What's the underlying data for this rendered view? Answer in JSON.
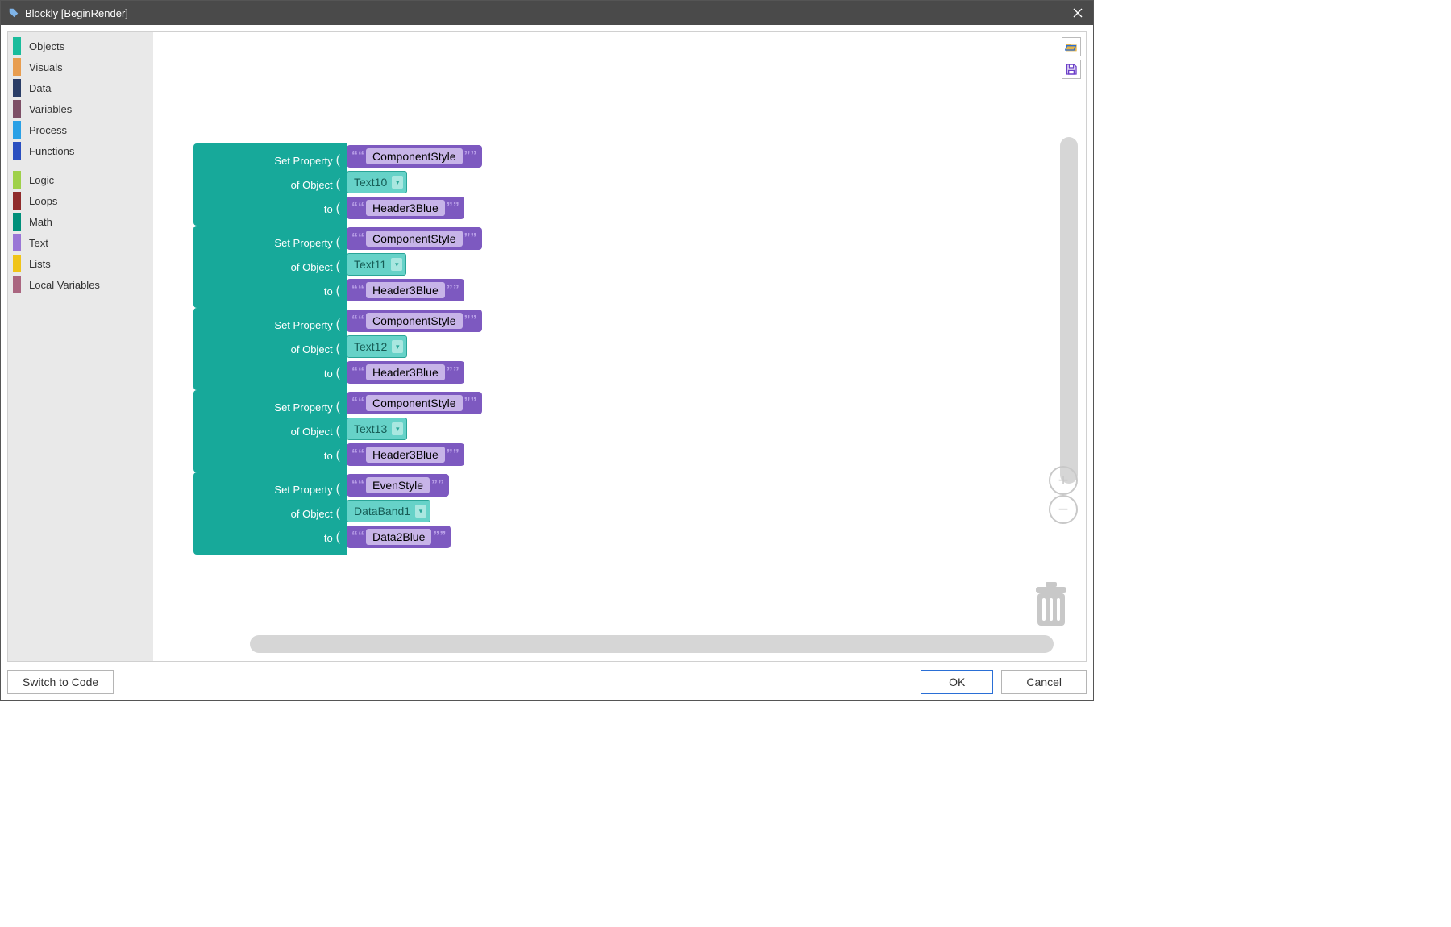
{
  "window_title": "Blockly [BeginRender]",
  "footer": {
    "switch": "Switch to Code",
    "ok": "OK",
    "cancel": "Cancel"
  },
  "sidebar": {
    "groups": [
      [
        {
          "color": "#1abc9c",
          "label": "Objects"
        },
        {
          "color": "#e89d4f",
          "label": "Visuals"
        },
        {
          "color": "#2a3d66",
          "label": "Data"
        },
        {
          "color": "#7d4f66",
          "label": "Variables"
        },
        {
          "color": "#2aa0e6",
          "label": "Process"
        },
        {
          "color": "#2a4fc0",
          "label": "Functions"
        }
      ],
      [
        {
          "color": "#9fd14a",
          "label": "Logic"
        },
        {
          "color": "#8f2b2b",
          "label": "Loops"
        },
        {
          "color": "#008f7a",
          "label": "Math"
        },
        {
          "color": "#9a76d6",
          "label": "Text"
        },
        {
          "color": "#f0c419",
          "label": "Lists"
        },
        {
          "color": "#aa6680",
          "label": "Local Variables"
        }
      ]
    ]
  },
  "set_block_labels": {
    "a": "Set Property",
    "b": "of Object",
    "c": "to"
  },
  "blocks": [
    {
      "property": "ComponentStyle",
      "object": "Text10",
      "value": "Header3Blue"
    },
    {
      "property": "ComponentStyle",
      "object": "Text11",
      "value": "Header3Blue"
    },
    {
      "property": "ComponentStyle",
      "object": "Text12",
      "value": "Header3Blue"
    },
    {
      "property": "ComponentStyle",
      "object": "Text13",
      "value": "Header3Blue"
    },
    {
      "property": "EvenStyle",
      "object": "DataBand1",
      "value": "Data2Blue"
    }
  ]
}
